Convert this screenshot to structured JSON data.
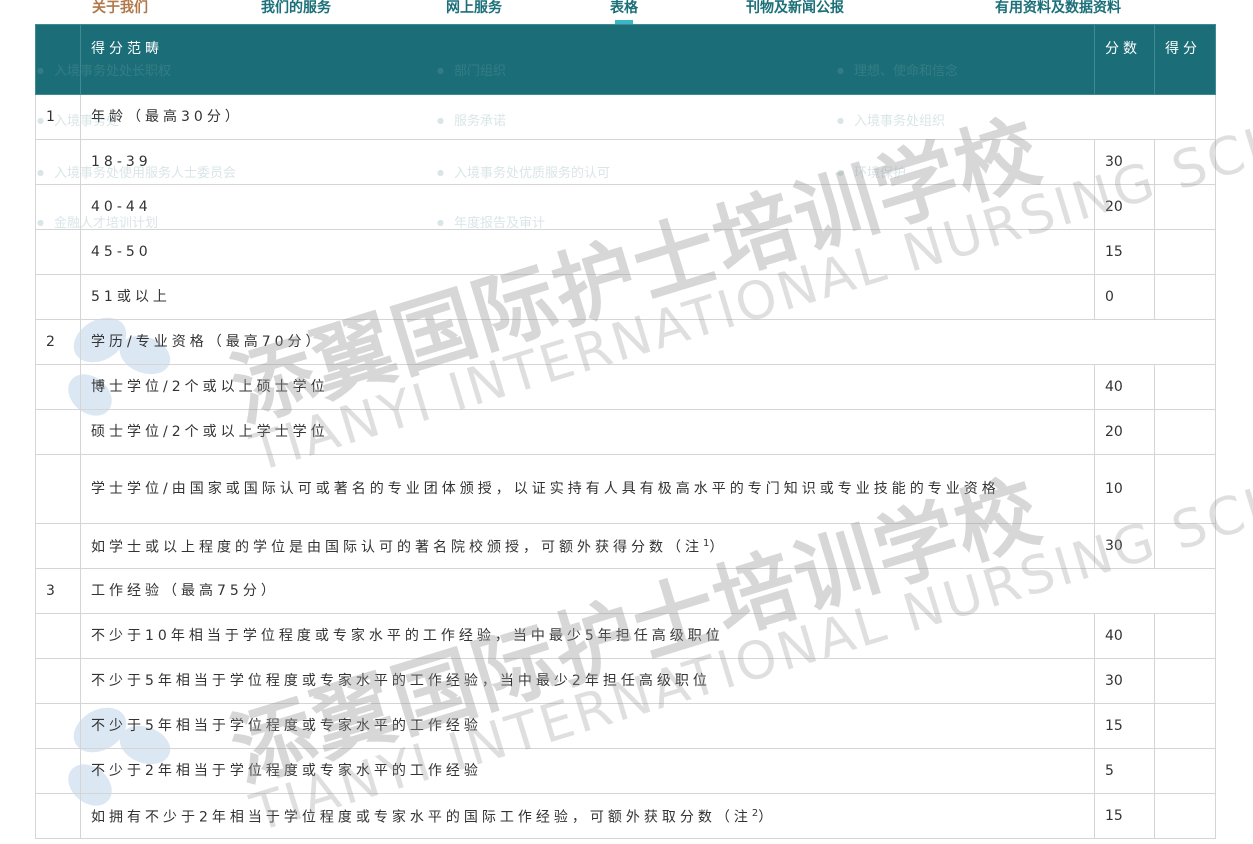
{
  "nav": {
    "items": [
      "关于我们",
      "我们的服务",
      "网上服务",
      "表格",
      "刊物及新闻公报",
      "有用资料及数据资料"
    ],
    "active_index": 3
  },
  "background_menu": {
    "items": [
      "入境事务处处长职权",
      "部门组织",
      "理想、使命和信念",
      "入境事务处",
      "服务承诺",
      "入境事务处组织",
      "入境事务处使用服务人士委员会",
      "入境事务处优质服务的认可",
      "环境保护",
      "金融人才培训计划",
      "年度报告及审计"
    ]
  },
  "table": {
    "headers": {
      "category": "得分范畴",
      "points": "分数",
      "score": "得分"
    },
    "rows": [
      {
        "type": "section",
        "num": "1",
        "label": "年龄（最高30分）"
      },
      {
        "type": "item",
        "label": "18-39",
        "points": "30"
      },
      {
        "type": "item",
        "label": "40-44",
        "points": "20"
      },
      {
        "type": "item",
        "label": "45-50",
        "points": "15"
      },
      {
        "type": "item",
        "label": "51或以上",
        "points": "0"
      },
      {
        "type": "section",
        "num": "2",
        "label": "学历/专业资格（最高70分）"
      },
      {
        "type": "item",
        "label": "博士学位/2个或以上硕士学位",
        "points": "40"
      },
      {
        "type": "item",
        "label": "硕士学位/2个或以上学士学位",
        "points": "20"
      },
      {
        "type": "item",
        "label": "学士学位/由国家或国际认可或著名的专业团体颁授，以证实持有人具有极高水平的专门知识或专业技能的专业资格",
        "points": "10",
        "tall": true
      },
      {
        "type": "item",
        "label": "如学士或以上程度的学位是由国际认可的著名院校颁授，可额外获得分数（注",
        "sup": "1",
        "label_end": "）",
        "points": "30"
      },
      {
        "type": "section",
        "num": "3",
        "label": "工作经验（最高75分）"
      },
      {
        "type": "item",
        "label": "不少于10年相当于学位程度或专家水平的工作经验，当中最少5年担任高级职位",
        "points": "40"
      },
      {
        "type": "item",
        "label": "不少于5年相当于学位程度或专家水平的工作经验，当中最少2年担任高级职位",
        "points": "30"
      },
      {
        "type": "item",
        "label": "不少于5年相当于学位程度或专家水平的工作经验",
        "points": "15"
      },
      {
        "type": "item",
        "label": "不少于2年相当于学位程度或专家水平的工作经验",
        "points": "5"
      },
      {
        "type": "item",
        "label": "如拥有不少于2年相当于学位程度或专家水平的国际工作经验，可额外获取分数（注",
        "sup": "2",
        "label_end": "）",
        "points": "15"
      }
    ]
  },
  "watermark": {
    "cn": "添翼国际护士培训学校",
    "en": "TIANYI INTERNATIONAL NURSING SCHOOL"
  },
  "colors": {
    "header_bg": "#1b6e78",
    "nav_text": "#1a6f78",
    "nav_first": "#b0784a",
    "active_indicator": "#39b8c4"
  }
}
